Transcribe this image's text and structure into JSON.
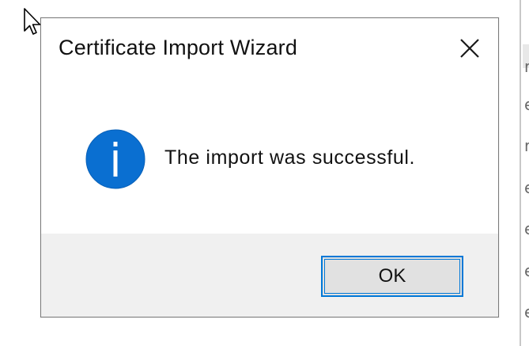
{
  "dialog": {
    "title": "Certificate Import Wizard",
    "message": "The import was successful.",
    "ok_label": "OK",
    "icon": "info-icon",
    "close_icon": "close-icon"
  },
  "background_window": {
    "text_fragments": [
      "r",
      "e",
      "r",
      "e",
      "e",
      "e",
      "e"
    ]
  },
  "colors": {
    "accent": "#0078d7",
    "footer_bg": "#f0f0f0",
    "button_bg": "#e1e1e1",
    "dialog_border": "#7a7a7a"
  }
}
